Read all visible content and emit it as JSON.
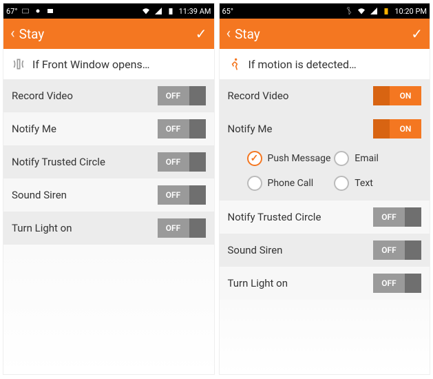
{
  "screens": {
    "left": {
      "status": {
        "temp": "67°",
        "time": "11:39 AM",
        "wifi": true,
        "bt": false
      },
      "header": {
        "title": "Stay"
      },
      "condition": {
        "icon": "sensor-icon",
        "text": "If Front Window opens…"
      },
      "rows": [
        {
          "label": "Record Video",
          "state": "OFF"
        },
        {
          "label": "Notify Me",
          "state": "OFF"
        },
        {
          "label": "Notify Trusted Circle",
          "state": "OFF"
        },
        {
          "label": "Sound Siren",
          "state": "OFF"
        },
        {
          "label": "Turn Light on",
          "state": "OFF"
        }
      ]
    },
    "right": {
      "status": {
        "temp": "65°",
        "time": "10:20 PM",
        "wifi": true,
        "bt": true
      },
      "header": {
        "title": "Stay"
      },
      "condition": {
        "icon": "motion-icon",
        "text": "If motion is detected…"
      },
      "rows": [
        {
          "label": "Record Video",
          "state": "ON"
        },
        {
          "label": "Notify Me",
          "state": "ON"
        },
        {
          "label": "Notify Trusted Circle",
          "state": "OFF"
        },
        {
          "label": "Sound Siren",
          "state": "OFF"
        },
        {
          "label": "Turn Light on",
          "state": "OFF"
        }
      ],
      "notify_options": [
        {
          "label": "Push Message",
          "selected": true
        },
        {
          "label": "Email",
          "selected": false
        },
        {
          "label": "Phone Call",
          "selected": false
        },
        {
          "label": "Text",
          "selected": false
        }
      ]
    }
  },
  "toggle_labels": {
    "on": "ON",
    "off": "OFF"
  }
}
